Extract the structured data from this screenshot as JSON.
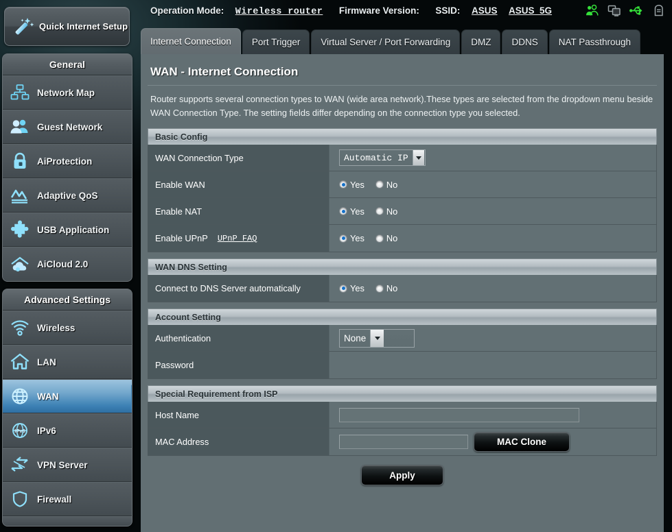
{
  "header": {
    "quick_setup_label": "Quick Internet Setup",
    "operation_mode_label": "Operation Mode:",
    "operation_mode_value": "Wireless router",
    "firmware_label": "Firmware Version:",
    "firmware_value": "",
    "ssid_label": "SSID:",
    "ssid_values": [
      "ASUS",
      "ASUS_5G"
    ],
    "icons": [
      {
        "name": "clients-users-icon",
        "color": "#35e03a"
      },
      {
        "name": "devices-screens-icon",
        "color": "#9aa3a6"
      },
      {
        "name": "usb-icon",
        "color": "#35e03a"
      },
      {
        "name": "printer-icon",
        "color": "#9aa3a6"
      }
    ]
  },
  "sidebar": {
    "groups": [
      {
        "title": "General",
        "items": [
          {
            "label": "Network Map",
            "icon": "network-map-icon",
            "active": false
          },
          {
            "label": "Guest Network",
            "icon": "guest-network-icon",
            "active": false
          },
          {
            "label": "AiProtection",
            "icon": "lock-shield-icon",
            "active": false
          },
          {
            "label": "Adaptive QoS",
            "icon": "qos-chart-icon",
            "active": false
          },
          {
            "label": "USB Application",
            "icon": "puzzle-piece-icon",
            "active": false
          },
          {
            "label": "AiCloud 2.0",
            "icon": "cloud-house-icon",
            "active": false
          }
        ]
      },
      {
        "title": "Advanced Settings",
        "items": [
          {
            "label": "Wireless",
            "icon": "wifi-signal-icon",
            "active": false
          },
          {
            "label": "LAN",
            "icon": "house-icon",
            "active": false
          },
          {
            "label": "WAN",
            "icon": "globe-icon",
            "active": true
          },
          {
            "label": "IPv6",
            "icon": "ipv6-globe-icon",
            "active": false
          },
          {
            "label": "VPN Server",
            "icon": "vpn-arrows-icon",
            "active": false
          },
          {
            "label": "Firewall",
            "icon": "shield-icon",
            "active": false
          }
        ]
      }
    ]
  },
  "tabs": [
    {
      "label": "Internet Connection",
      "active": true
    },
    {
      "label": "Port Trigger",
      "active": false
    },
    {
      "label": "Virtual Server / Port Forwarding",
      "active": false
    },
    {
      "label": "DMZ",
      "active": false
    },
    {
      "label": "DDNS",
      "active": false
    },
    {
      "label": "NAT Passthrough",
      "active": false
    }
  ],
  "page": {
    "title": "WAN - Internet Connection",
    "description": "Router supports several connection types to WAN (wide area network).These types are selected from the dropdown menu beside WAN Connection Type. The setting fields differ depending on the connection type you selected."
  },
  "sections": {
    "basic_config": {
      "title": "Basic Config",
      "wan_connection_type": {
        "label": "WAN Connection Type",
        "value": "Automatic IP"
      },
      "enable_wan": {
        "label": "Enable WAN",
        "yes": "Yes",
        "no": "No",
        "selected": "Yes"
      },
      "enable_nat": {
        "label": "Enable NAT",
        "yes": "Yes",
        "no": "No",
        "selected": "Yes"
      },
      "enable_upnp": {
        "label": "Enable UPnP",
        "link": "UPnP FAQ",
        "yes": "Yes",
        "no": "No",
        "selected": "Yes"
      }
    },
    "wan_dns": {
      "title": "WAN DNS Setting",
      "connect_dns_auto": {
        "label": "Connect to DNS Server automatically",
        "yes": "Yes",
        "no": "No",
        "selected": "Yes"
      }
    },
    "account": {
      "title": "Account Setting",
      "authentication": {
        "label": "Authentication",
        "value": "None"
      },
      "password": {
        "label": "Password",
        "value": ""
      }
    },
    "isp": {
      "title": "Special Requirement from ISP",
      "host_name": {
        "label": "Host Name",
        "value": "",
        "placeholder": ""
      },
      "mac_address": {
        "label": "MAC Address",
        "value": "",
        "placeholder": "",
        "clone_button": "MAC Clone"
      }
    }
  },
  "apply_button": "Apply",
  "colors": {
    "accent_blue": "#3e82b5",
    "panel": "#626f73",
    "row_label": "#4b585c",
    "icon_glow": "#6fd4f5",
    "status_green": "#35e03a"
  }
}
